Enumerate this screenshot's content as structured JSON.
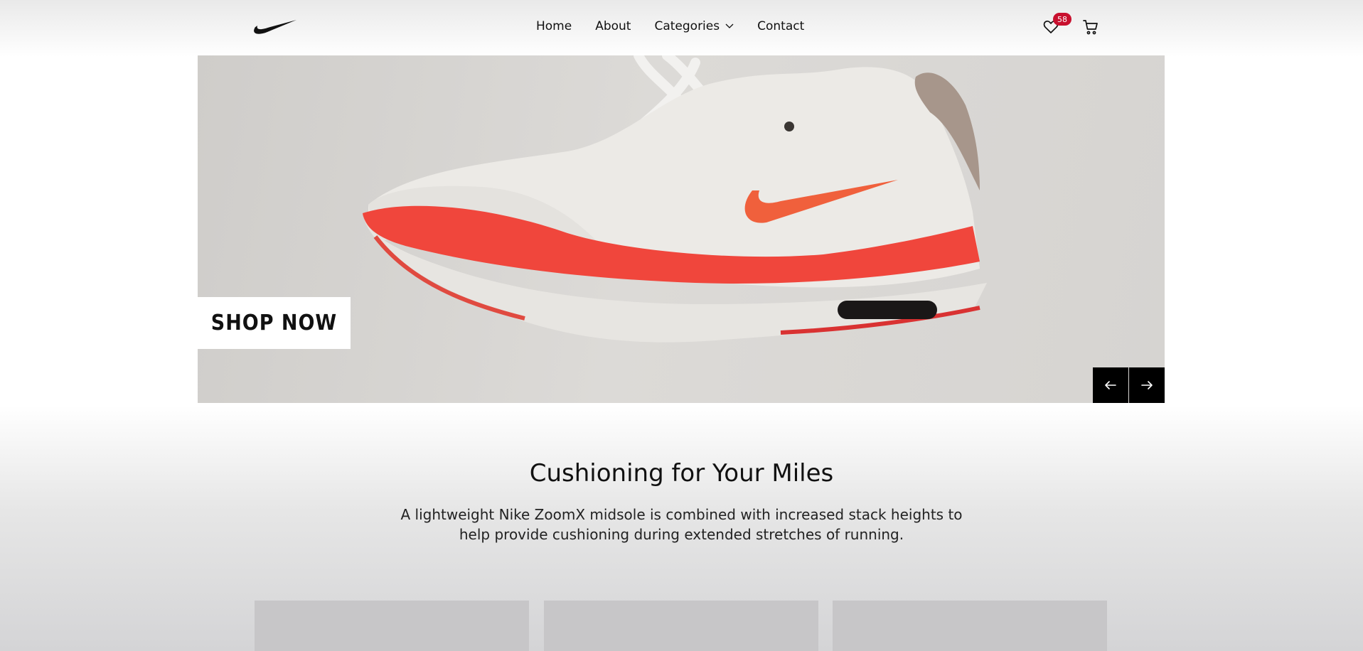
{
  "header": {
    "logo": "nike-swoosh",
    "nav": [
      "Home",
      "About",
      "Categories",
      "Contact"
    ],
    "wishlist_count": "58",
    "badge_color": "#c8102e"
  },
  "hero": {
    "cta_label": "SHOP NOW",
    "prev_icon": "arrow-left-icon",
    "next_icon": "arrow-right-icon"
  },
  "feature": {
    "title": "Cushioning for Your Miles",
    "desc_line1": "A lightweight Nike ZoomX midsole is combined with increased stack heights to",
    "desc_line2": "help provide cushioning during extended stretches of running."
  },
  "colors": {
    "accent": "#000000",
    "shoe_red": "#f0463c"
  }
}
